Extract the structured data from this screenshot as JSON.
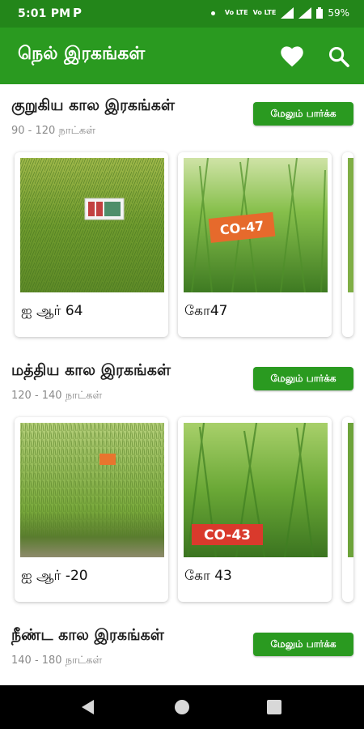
{
  "status_bar": {
    "time": "5:01 PM",
    "app_glyph": "P",
    "volte1": "Vo LTE",
    "volte2": "Vo LTE",
    "battery": "59%"
  },
  "app_bar": {
    "title": "நெல் இரகங்கள்"
  },
  "sections": [
    {
      "title": "குறுகிய கால இரகங்கள்",
      "subtitle": "90 - 120 நாட்கள்",
      "more_label": "மேலும் பார்க்க",
      "cards": [
        {
          "label": "ஐ ஆர் 64"
        },
        {
          "label": "கோ47",
          "tag": "CO-47"
        }
      ]
    },
    {
      "title": "மத்திய கால இரகங்கள்",
      "subtitle": "120 - 140 நாட்கள்",
      "more_label": "மேலும் பார்க்க",
      "cards": [
        {
          "label": "ஐ ஆர் -20"
        },
        {
          "label": "கோ 43",
          "tag": "CO-43"
        }
      ]
    },
    {
      "title": "நீண்ட கால இரகங்கள்",
      "subtitle": "140 - 180 நாட்கள்",
      "more_label": "மேலும் பார்க்க"
    }
  ],
  "colors": {
    "app_bar": "#2a9a20",
    "status_bar": "#23861a",
    "button": "#2a9a20"
  },
  "icons": {
    "favorite": "heart-icon",
    "search": "search-icon",
    "back": "back-icon",
    "home": "home-icon",
    "recents": "recents-icon"
  }
}
